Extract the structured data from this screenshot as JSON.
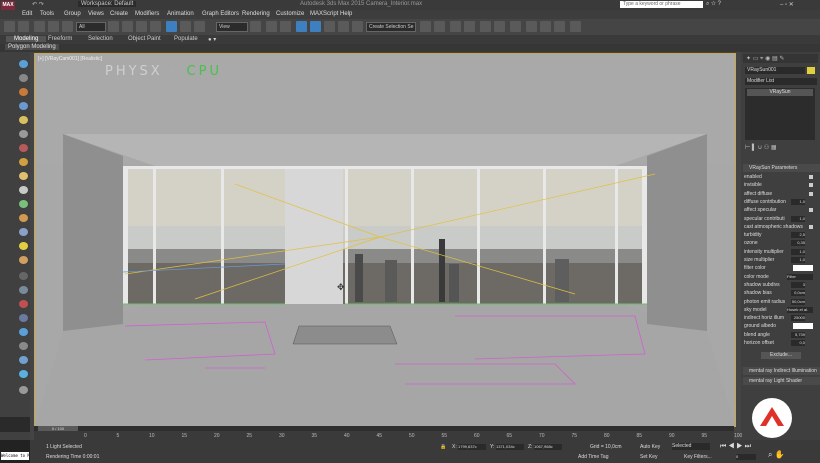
{
  "app": {
    "logo_text": "MAX",
    "workspace_label": "Workspace: Default",
    "title_text": "Autodesk 3ds Max 2015    Camera_Interior.max",
    "search_placeholder": "Type a keyword or phrase"
  },
  "menu": [
    "Edit",
    "Tools",
    "Group",
    "Views",
    "Create",
    "Modifiers",
    "Animation",
    "Graph Editors",
    "Rendering",
    "Customize",
    "MAXScript",
    "Help"
  ],
  "toolbar": {
    "filter_value": "All",
    "view_value": "View",
    "selection_set_value": "Create Selection Se"
  },
  "ribbon": {
    "tabs": [
      "Modeling",
      "Freeform",
      "Selection",
      "Object Paint",
      "Populate"
    ],
    "active_index": 0,
    "sub_label": "Polygon Modeling"
  },
  "viewport": {
    "label": "[+] [VRayCam001] [Realistic]",
    "overlay_text_1": "PHYSX",
    "overlay_text_2": "CPU",
    "cursor_glyph": "✥"
  },
  "command_panel": {
    "object_name": "VRaySun001",
    "modifier_list": "Modifier List",
    "modifier_item": "VRaySun",
    "rollout_title": "VRaySun Parameters",
    "params": [
      {
        "label": "enabled",
        "type": "check"
      },
      {
        "label": "invisible",
        "type": "check"
      },
      {
        "label": "affect diffuse",
        "type": "check"
      },
      {
        "label": "diffuse contribution",
        "type": "value",
        "value": "1,0"
      },
      {
        "label": "affect specular",
        "type": "check"
      },
      {
        "label": "specular contributi",
        "type": "value",
        "value": "1,0"
      },
      {
        "label": "cast atmospheric shadows",
        "type": "check"
      },
      {
        "label": "turbidity",
        "type": "value",
        "value": "2,5"
      },
      {
        "label": "ozone",
        "type": "value",
        "value": "0,35"
      },
      {
        "label": "intensity multiplier",
        "type": "value",
        "value": "1,0"
      },
      {
        "label": "size multiplier",
        "type": "value",
        "value": "1,0"
      },
      {
        "label": "filter color",
        "type": "swatch"
      },
      {
        "label": "color mode",
        "type": "select",
        "value": "Filter"
      },
      {
        "label": "shadow subdivs",
        "type": "value",
        "value": "3"
      },
      {
        "label": "shadow bias",
        "type": "value",
        "value": "0,0cm"
      },
      {
        "label": "photon emit radius",
        "type": "value",
        "value": "50,0cm"
      },
      {
        "label": "sky model",
        "type": "select",
        "value": "Hosek et al."
      },
      {
        "label": "indirect horiz illum",
        "type": "value",
        "value": "25000"
      },
      {
        "label": "ground albedo",
        "type": "swatch"
      },
      {
        "label": "blend angle",
        "type": "value",
        "value": "5,739"
      },
      {
        "label": "horizon offset",
        "type": "value",
        "value": "0,0"
      }
    ],
    "exclude_label": "Exclude...",
    "collapsed_rollouts": [
      "mental ray Indirect Illumination",
      "mental ray Light Shader"
    ]
  },
  "timeline": {
    "frame_counter": "0 / 100",
    "ticks": [
      "0",
      "5",
      "10",
      "15",
      "20",
      "25",
      "30",
      "35",
      "40",
      "45",
      "50",
      "55",
      "60",
      "65",
      "70",
      "75",
      "80",
      "85",
      "90",
      "95",
      "100"
    ]
  },
  "status": {
    "maxscript_text": "Welcome to M",
    "selection_text": "1 Light Selected",
    "rendering_text": "Rendering Time  0:00:01",
    "x_label": "X:",
    "x_value": "1799,637c",
    "y_label": "Y:",
    "y_value": "1371,034c",
    "z_label": "Z:",
    "z_value": "1067,968c",
    "grid_text": "Grid = 10,0cm",
    "auto_key_label": "Auto Key",
    "auto_key_value": "Selected",
    "set_key_label": "Set Key",
    "key_filters_label": "Key Filters...",
    "add_time_tag_label": "Add Time Tag",
    "frame_field": "0"
  }
}
